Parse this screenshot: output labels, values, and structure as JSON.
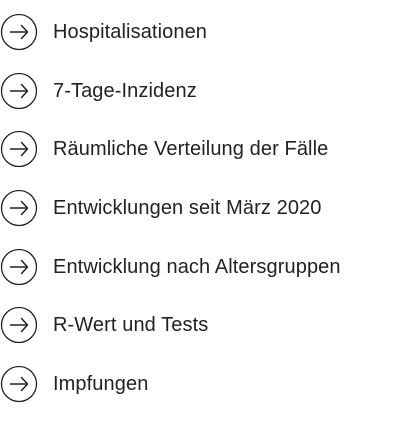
{
  "links": {
    "items": [
      {
        "label": "Hospitalisationen",
        "icon": "arrow-right-circle-icon"
      },
      {
        "label": "7-Tage-Inzidenz",
        "icon": "arrow-right-circle-icon"
      },
      {
        "label": "Räumliche Verteilung der Fälle",
        "icon": "arrow-right-circle-icon"
      },
      {
        "label": "Entwicklungen seit März 2020",
        "icon": "arrow-right-circle-icon"
      },
      {
        "label": "Entwicklung nach Altersgruppen",
        "icon": "arrow-right-circle-icon"
      },
      {
        "label": "R-Wert und Tests",
        "icon": "arrow-right-circle-icon"
      },
      {
        "label": "Impfungen",
        "icon": "arrow-right-circle-icon"
      }
    ]
  },
  "colors": {
    "text": "#222222",
    "icon": "#222222",
    "background": "#ffffff"
  }
}
